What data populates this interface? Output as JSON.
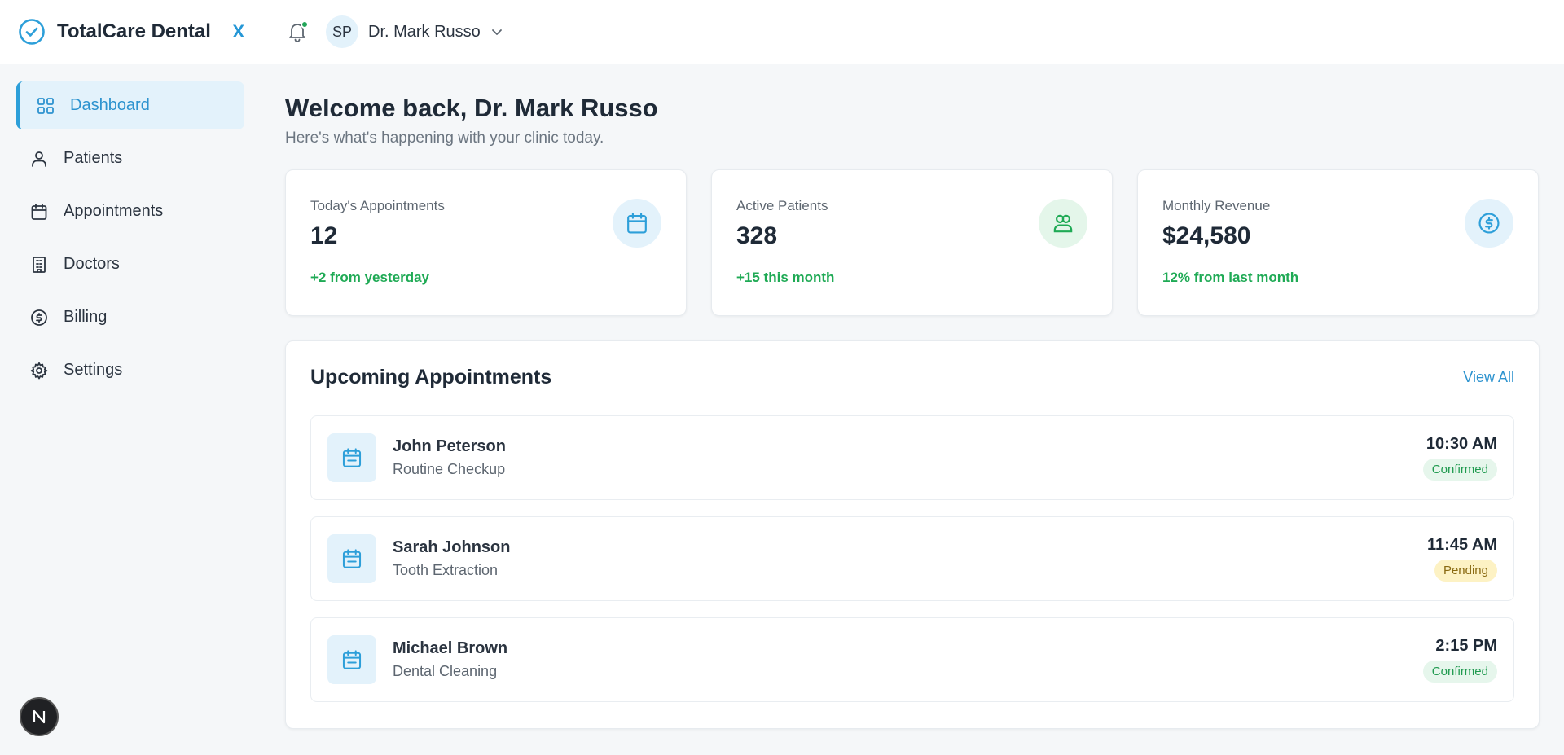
{
  "brand": {
    "name": "TotalCare Dental",
    "close_label": "X"
  },
  "sidebar": {
    "items": [
      {
        "label": "Dashboard",
        "icon": "grid-icon",
        "active": true
      },
      {
        "label": "Patients",
        "icon": "users-icon"
      },
      {
        "label": "Appointments",
        "icon": "calendar-icon"
      },
      {
        "label": "Doctors",
        "icon": "building-icon"
      },
      {
        "label": "Billing",
        "icon": "dollar-circle-icon"
      },
      {
        "label": "Settings",
        "icon": "gear-icon"
      }
    ]
  },
  "header": {
    "user_initials": "SP",
    "user_name": "Dr. Mark Russo",
    "has_notification": true
  },
  "main": {
    "welcome": "Welcome back, Dr. Mark Russo",
    "subtitle": "Here's what's happening with your clinic today."
  },
  "stats": [
    {
      "label": "Today's Appointments",
      "value": "12",
      "note": "+2 from yesterday",
      "icon": "calendar-icon",
      "icon_bg": "#e3f2fb",
      "icon_color": "#2d9fd9"
    },
    {
      "label": "Active Patients",
      "value": "328",
      "note": "+15 this month",
      "icon": "users-icon",
      "icon_bg": "#e4f6ea",
      "icon_color": "#1faa55"
    },
    {
      "label": "Monthly Revenue",
      "value": "$24,580",
      "note": "12% from last month",
      "icon": "dollar-circle-icon",
      "icon_bg": "#e3f2fb",
      "icon_color": "#2d9fd9"
    }
  ],
  "appointments": {
    "title": "Upcoming Appointments",
    "view_all": "View All",
    "rows": [
      {
        "name": "John Peterson",
        "type": "Routine Checkup",
        "time": "10:30 AM",
        "status": "Confirmed"
      },
      {
        "name": "Sarah Johnson",
        "type": "Tooth Extraction",
        "time": "11:45 AM",
        "status": "Pending"
      },
      {
        "name": "Michael Brown",
        "type": "Dental Cleaning",
        "time": "2:15 PM",
        "status": "Confirmed"
      }
    ]
  },
  "colors": {
    "accent": "#2d9fd9",
    "success": "#1faa55",
    "pending_bg": "#fdf2c4"
  }
}
